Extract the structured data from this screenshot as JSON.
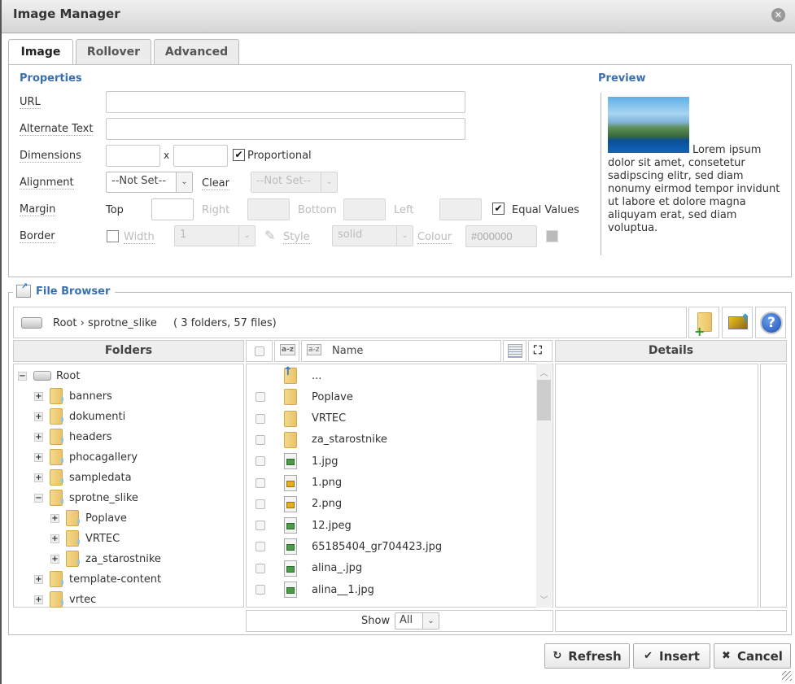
{
  "window": {
    "title": "Image Manager",
    "close_icon": "close-icon"
  },
  "tabs": [
    {
      "label": "Image",
      "active": true
    },
    {
      "label": "Rollover",
      "active": false
    },
    {
      "label": "Advanced",
      "active": false
    }
  ],
  "properties": {
    "heading": "Properties",
    "url": {
      "label": "URL",
      "value": ""
    },
    "alt": {
      "label": "Alternate Text",
      "value": ""
    },
    "dimensions": {
      "label": "Dimensions",
      "width": "",
      "height": "",
      "separator": "x",
      "proportional_label": "Proportional",
      "proportional": true
    },
    "alignment": {
      "label": "Alignment",
      "value": "--Not Set--",
      "clear_label": "Clear",
      "clear_value": "--Not Set--"
    },
    "margin": {
      "label": "Margin",
      "top_label": "Top",
      "right_label": "Right",
      "bottom_label": "Bottom",
      "left_label": "Left",
      "top": "",
      "right": "",
      "bottom": "",
      "left": "",
      "equal_label": "Equal Values",
      "equal": true
    },
    "border": {
      "label": "Border",
      "enabled": false,
      "width_label": "Width",
      "width_value": "1",
      "style_label": "Style",
      "style_value": "solid",
      "colour_label": "Colour",
      "colour_value": "#000000"
    }
  },
  "preview": {
    "heading": "Preview",
    "text": "Lorem ipsum dolor sit amet, consetetur sadipscing elitr, sed diam nonumy eirmod tempor invidunt ut labore et dolore magna aliquyam erat, sed diam voluptua."
  },
  "file_browser": {
    "heading": "File Browser",
    "path_root": "Root",
    "path_sep": "›",
    "path_current": "sprotne_slike",
    "counts": "( 3 folders, 57 files)",
    "folders_header": "Folders",
    "name_header": "Name",
    "details_header": "Details",
    "show_label": "Show",
    "show_value": "All",
    "tree": [
      {
        "label": "Root",
        "level": 0,
        "toggle": "−",
        "type": "drive"
      },
      {
        "label": "banners",
        "level": 1,
        "toggle": "+"
      },
      {
        "label": "dokumenti",
        "level": 1,
        "toggle": "+"
      },
      {
        "label": "headers",
        "level": 1,
        "toggle": "+"
      },
      {
        "label": "phocagallery",
        "level": 1,
        "toggle": "+"
      },
      {
        "label": "sampledata",
        "level": 1,
        "toggle": "+"
      },
      {
        "label": "sprotne_slike",
        "level": 1,
        "toggle": "−"
      },
      {
        "label": "Poplave",
        "level": 2,
        "toggle": "+"
      },
      {
        "label": "VRTEC",
        "level": 2,
        "toggle": "+"
      },
      {
        "label": "za_starostnike",
        "level": 2,
        "toggle": "+"
      },
      {
        "label": "template-content",
        "level": 1,
        "toggle": "+"
      },
      {
        "label": "vrtec",
        "level": 1,
        "toggle": "+"
      }
    ],
    "files": [
      {
        "name": "...",
        "type": "up"
      },
      {
        "name": "Poplave",
        "type": "folder"
      },
      {
        "name": "VRTEC",
        "type": "folder"
      },
      {
        "name": "za_starostnike",
        "type": "folder"
      },
      {
        "name": "1.jpg",
        "type": "jpg"
      },
      {
        "name": "1.png",
        "type": "png"
      },
      {
        "name": "2.png",
        "type": "png"
      },
      {
        "name": "12.jpeg",
        "type": "jpg"
      },
      {
        "name": "65185404_gr704423.jpg",
        "type": "jpg"
      },
      {
        "name": "alina_.jpg",
        "type": "jpg"
      },
      {
        "name": "alina__1.jpg",
        "type": "jpg"
      }
    ]
  },
  "buttons": {
    "refresh": "Refresh",
    "insert": "Insert",
    "cancel": "Cancel"
  }
}
